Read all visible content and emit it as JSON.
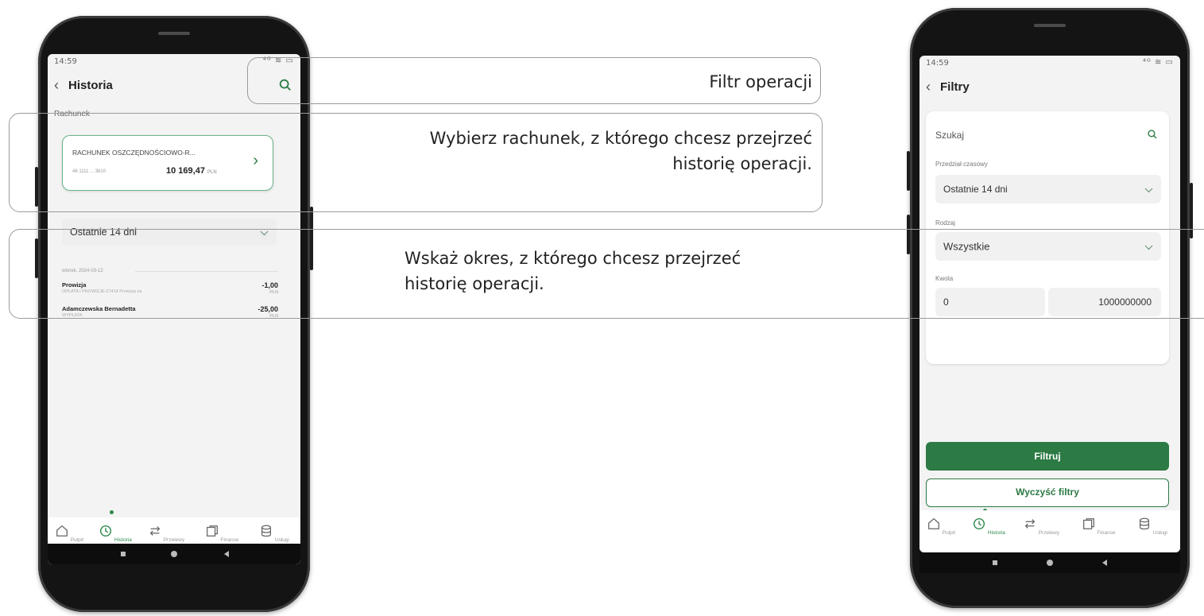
{
  "left_phone": {
    "status_time": "14:59",
    "status_icons": "⁴ᴳ ≋ ▭",
    "title": "Historia",
    "section_label": "Rachunek",
    "account": {
      "name": "RACHUNEK OSZCZĘDNOŚCIOWO-R...",
      "number": "46 1111 ... 3610",
      "balance": "10 169,47",
      "currency": "PLN"
    },
    "period": "Ostatnie 14 dni",
    "date_header": "wtorek, 2024-03-12",
    "transactions": [
      {
        "title": "Prowizja",
        "subtitle": "OPŁATA I PROWIZJE-27414 Prowizja za",
        "amount": "-1,00",
        "currency": "PLN"
      },
      {
        "title": "Adamczewska Bernadetta",
        "subtitle": "WYPŁATA",
        "amount": "-25,00",
        "currency": "PLN"
      }
    ],
    "nav": [
      {
        "label": "Pulpit",
        "icon": "home-icon"
      },
      {
        "label": "Historia",
        "icon": "history-icon"
      },
      {
        "label": "Przelewy",
        "icon": "transfer-icon"
      },
      {
        "label": "Finanse",
        "icon": "finance-icon"
      },
      {
        "label": "Usługi",
        "icon": "services-icon"
      }
    ]
  },
  "right_phone": {
    "status_time": "14:59",
    "status_icons": "⁴ᴳ ≋ ▭",
    "title": "Filtry",
    "search_placeholder": "Szukaj",
    "period_label": "Przedział czasowy",
    "period_value": "Ostatnie 14 dni",
    "type_label": "Rodzaj",
    "type_value": "Wszystkie",
    "amount_label": "Kwota",
    "amount_from": "0",
    "amount_to": "1000000000",
    "filter_button": "Filtruj",
    "clear_button": "Wyczyść filtry",
    "nav": [
      {
        "label": "Pulpit",
        "icon": "home-icon"
      },
      {
        "label": "Historia",
        "icon": "history-icon"
      },
      {
        "label": "Przelewy",
        "icon": "transfer-icon"
      },
      {
        "label": "Finanse",
        "icon": "finance-icon"
      },
      {
        "label": "Usługi",
        "icon": "services-icon"
      }
    ]
  },
  "callouts": {
    "filter": "Filtr operacji",
    "account_line1": "Wybierz rachunek, z którego chcesz przejrzeć",
    "account_line2": "historię operacji.",
    "period_line1": "Wskaż okres, z którego chcesz przejrzeć",
    "period_line2": "historię operacji."
  },
  "colors": {
    "accent": "#2c7a44",
    "callout_border": "#9b9b9b"
  }
}
